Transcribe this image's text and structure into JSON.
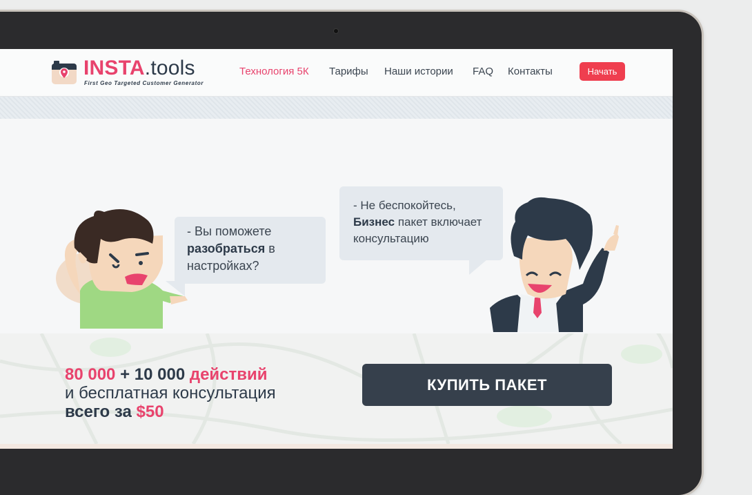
{
  "brand": {
    "name_part1": "INSTA",
    "name_part2": ".tools",
    "tagline": "First Geo Targeted Customer Generator"
  },
  "nav": {
    "items": [
      {
        "label": "Технология 5К",
        "active": true
      },
      {
        "label": "Тарифы",
        "active": false
      },
      {
        "label": "Наши истории",
        "active": false
      },
      {
        "label": "FAQ",
        "active": false
      },
      {
        "label": "Контакты",
        "active": false
      }
    ],
    "start_label": "Начать"
  },
  "dialog": {
    "left": {
      "prefix": "- Вы поможете",
      "bold": "разобраться",
      "suffix_same_line": "в",
      "rest": "настройках?"
    },
    "right": {
      "line1": "- Не беспокойтесь,",
      "bold": "Бизнес",
      "rest1": "пакет включает",
      "rest2": "консультацию"
    }
  },
  "offer": {
    "amount1": "80 000",
    "plus": "+ 10 000",
    "actions": "действий",
    "line2": "и бесплатная консультация",
    "price_prefix": "всего за",
    "price": "$50",
    "buy_label": "КУПИТЬ ПАКЕТ"
  },
  "colors": {
    "accent": "#e8436d",
    "dark": "#2d3a49",
    "start_button": "#ef3e4f",
    "buy_button": "#36404c"
  }
}
